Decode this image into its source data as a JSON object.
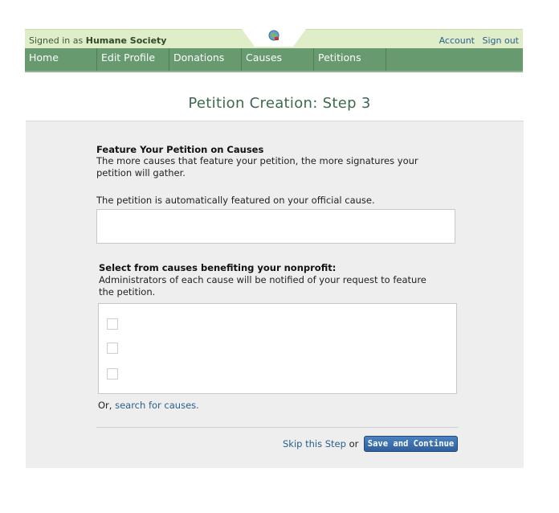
{
  "header": {
    "signed_in_prefix": "Signed in as",
    "org_name": "Humane Society",
    "links": [
      "Account",
      "Sign out"
    ],
    "logo_icon": "globe-icon"
  },
  "nav": {
    "items": [
      "Home",
      "Edit Profile",
      "Donations",
      "Causes",
      "Petitions"
    ]
  },
  "page": {
    "title": "Petition Creation: Step 3"
  },
  "feature": {
    "heading": "Feature Your Petition on Causes",
    "description": "The more causes that feature your petition, the more signatures your petition will gather.",
    "auto_note": "The petition is automatically featured on your official cause."
  },
  "select": {
    "heading": "Select from causes benefiting your nonprofit:",
    "description": "Administrators of each cause will be notified of your request to feature the petition.",
    "checkboxes": [
      false,
      false,
      false
    ]
  },
  "search": {
    "prefix": "Or,",
    "link": "search for causes."
  },
  "actions": {
    "skip_link": "Skip this Step",
    "or_text": "or",
    "save_button": "Save and Continue"
  },
  "colors": {
    "nav_green": "#679a6e",
    "topbar_green": "#dfedc9",
    "link_blue": "#2a5f8a",
    "title_green": "#3b6a4e"
  }
}
